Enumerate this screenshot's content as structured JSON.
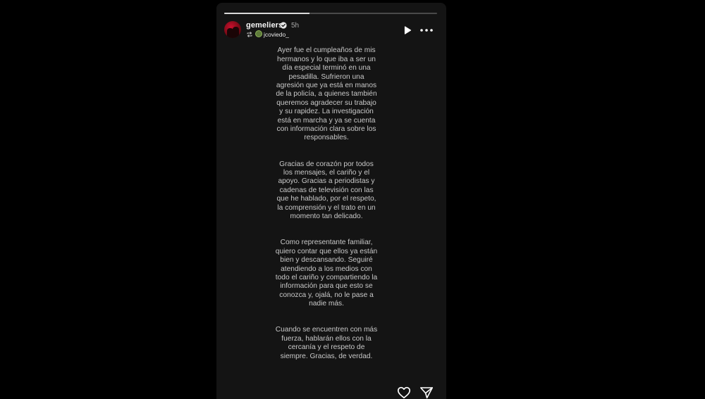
{
  "story": {
    "progress": 0.4,
    "header": {
      "username": "gemeliers",
      "time": "5h",
      "reposted_from": "jcoviedo_"
    },
    "paragraphs": [
      "Ayer fue el cumpleaños de mis hermanos y lo que iba a ser un día especial terminó en una pesadilla. Sufrieron una agresión que ya está en manos de la policía, a quienes también queremos agradecer su trabajo y su rapidez. La investigación está en marcha y ya se cuenta con información clara sobre los responsables.",
      "Gracias de corazón por todos los mensajes, el cariño y el apoyo. Gracias a periodistas y cadenas de televisión con las que he hablado, por el respeto, la comprensión y el trato en un momento tan delicado.",
      "Como representante familiar, quiero contar que ellos ya están bien y descansando. Seguiré atendiendo a los medios con todo el cariño y compartiendo la información para que esto se conozca y, ojalá, no le pase a nadie más.",
      "Cuando se encuentren con más fuerza, hablarán ellos con la cercanía y el respeto de siempre. Gracias, de verdad."
    ],
    "icons": {
      "verified": "verified-badge-icon",
      "repost": "repost-icon",
      "play": "play-icon",
      "more": "more-options-icon",
      "like": "heart-icon",
      "share": "paper-plane-icon"
    },
    "colors": {
      "background": "#000000",
      "story_bg": "#141414",
      "text": "#c9c9c9",
      "username": "#f5f5f5"
    }
  }
}
